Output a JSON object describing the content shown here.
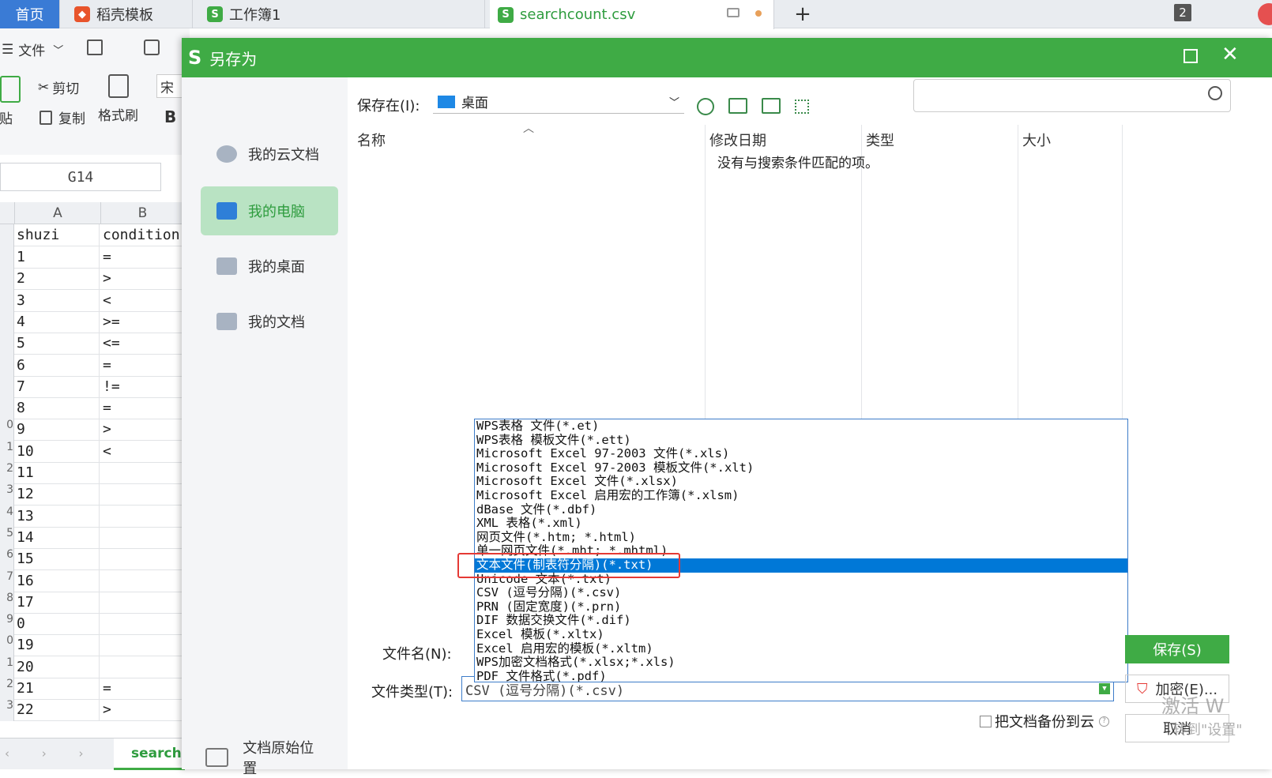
{
  "tabs": {
    "home": "首页",
    "template": "稻壳模板",
    "workbook": "工作簿1",
    "file": "searchcount.csv",
    "new_tab": "+",
    "count": "2"
  },
  "ribbon": {
    "file_menu": "文件",
    "cut": "剪切",
    "paste": "粘贴",
    "copy": "复制",
    "format_painter": "格式刷",
    "font_stub": "宋",
    "bold": "B"
  },
  "sheet": {
    "name_box": "G14",
    "col_a": "A",
    "col_b": "B",
    "header_a": "shuzi",
    "header_b": "condition",
    "row_numbers": [
      "",
      "",
      "",
      "",
      "",
      "",
      "",
      "",
      "",
      "0",
      "1",
      "2",
      "3",
      "4",
      "5",
      "6",
      "7",
      "8",
      "9",
      "0",
      "1",
      "2",
      "3"
    ],
    "col_a_values": [
      "1",
      "2",
      "3",
      "4",
      "5",
      "6",
      "7",
      "8",
      "9",
      "10",
      "11",
      "12",
      "13",
      "14",
      "15",
      "16",
      "17",
      "0",
      "19",
      "20",
      "21",
      "22"
    ],
    "col_b_values": [
      "=",
      ">",
      "<",
      ">=",
      "<=",
      "=",
      "!=",
      "=",
      ">",
      "<",
      "",
      "",
      "",
      "",
      "",
      "",
      "",
      "",
      "",
      "",
      "=",
      ">"
    ],
    "sheet_tab": "searchc"
  },
  "dialog": {
    "title": "另存为",
    "nav": [
      "我的云文档",
      "我的电脑",
      "我的桌面",
      "我的文档"
    ],
    "original_location": "文档原始位置",
    "save_in_label": "保存在(I):",
    "save_in_value": "桌面",
    "columns": [
      "名称",
      "修改日期",
      "类型",
      "大小"
    ],
    "empty_message": "没有与搜索条件匹配的项。",
    "filename_label": "文件名(N):",
    "filetype_label": "文件类型(T):",
    "filetype_value": "CSV (逗号分隔)(*.csv)",
    "filetype_options": [
      "WPS表格 文件(*.et)",
      "WPS表格 模板文件(*.ett)",
      "Microsoft Excel 97-2003 文件(*.xls)",
      "Microsoft Excel 97-2003 模板文件(*.xlt)",
      "Microsoft Excel 文件(*.xlsx)",
      "Microsoft Excel 启用宏的工作簿(*.xlsm)",
      "dBase 文件(*.dbf)",
      "XML 表格(*.xml)",
      "网页文件(*.htm; *.html)",
      "单一网页文件(*.mht; *.mhtml)",
      "文本文件(制表符分隔)(*.txt)",
      "Unicode 文本(*.txt)",
      "CSV (逗号分隔)(*.csv)",
      "PRN (固定宽度)(*.prn)",
      "DIF 数据交换文件(*.dif)",
      "Excel 模板(*.xltx)",
      "Excel 启用宏的模板(*.xltm)",
      "WPS加密文档格式(*.xlsx;*.xls)",
      "PDF 文件格式(*.pdf)"
    ],
    "selected_option_index": 10,
    "backup_label": "把文档备份到云",
    "save_button": "保存(S)",
    "encrypt_button": "加密(E)...",
    "cancel_button": "取消",
    "watermark_line1": "激活 W",
    "watermark_line2": "转到\"设置\""
  },
  "colors": {
    "accent_green": "#3fab45",
    "selection_blue": "#0078d7",
    "highlight_red": "#e53935",
    "nav_selected_bg": "#b9e3c3"
  }
}
